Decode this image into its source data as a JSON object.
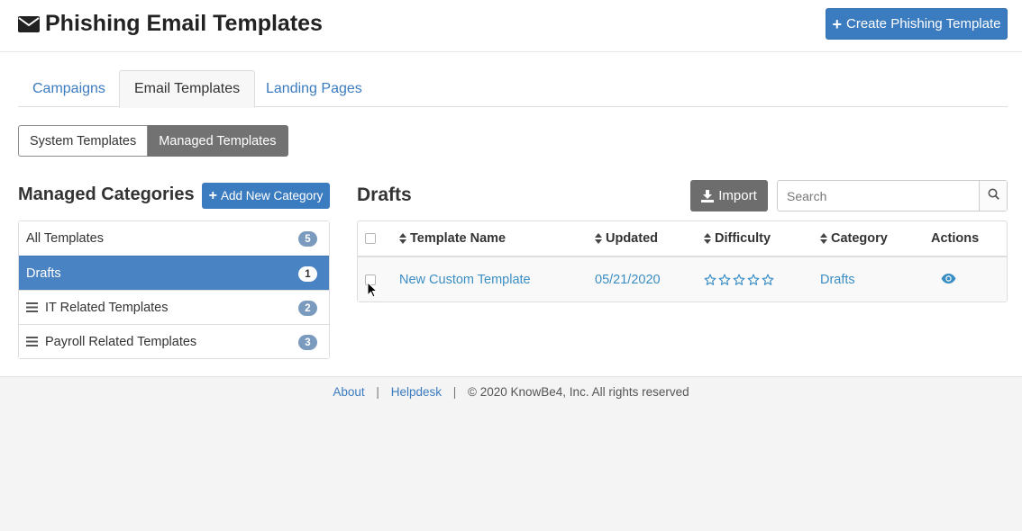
{
  "header": {
    "title": "Phishing Email Templates",
    "title_icon": "envelope-icon",
    "create_button": "Create Phishing Template"
  },
  "tabs": [
    {
      "label": "Campaigns",
      "active": false
    },
    {
      "label": "Email Templates",
      "active": true
    },
    {
      "label": "Landing Pages",
      "active": false
    }
  ],
  "template_toggle": {
    "system": "System Templates",
    "managed": "Managed Templates",
    "selected": "Managed Templates"
  },
  "categories": {
    "title": "Managed Categories",
    "add_button": "Add New Category",
    "items": [
      {
        "label": "All Templates",
        "count": "5",
        "draggable": false,
        "active": false
      },
      {
        "label": "Drafts",
        "count": "1",
        "draggable": false,
        "active": true
      },
      {
        "label": "IT Related Templates",
        "count": "2",
        "draggable": true,
        "active": false
      },
      {
        "label": "Payroll Related Templates",
        "count": "3",
        "draggable": true,
        "active": false
      }
    ]
  },
  "drafts": {
    "title": "Drafts",
    "import_button": "Import",
    "search_placeholder": "Search",
    "columns": [
      "Template Name",
      "Updated",
      "Difficulty",
      "Category",
      "Actions"
    ],
    "rows": [
      {
        "name": "New Custom Template",
        "updated": "05/21/2020",
        "difficulty_stars": 0,
        "difficulty_max": 5,
        "category": "Drafts",
        "action_icon": "eye-icon"
      }
    ]
  },
  "footer": {
    "about": "About",
    "helpdesk": "Helpdesk",
    "copyright": "© 2020 KnowBe4, Inc. All rights reserved"
  },
  "colors": {
    "primary": "#3b7bbf",
    "link": "#3b8ec4",
    "active_category": "#4a83c4",
    "import_button": "#6d6d6d",
    "badge": "#7b9bbe"
  }
}
